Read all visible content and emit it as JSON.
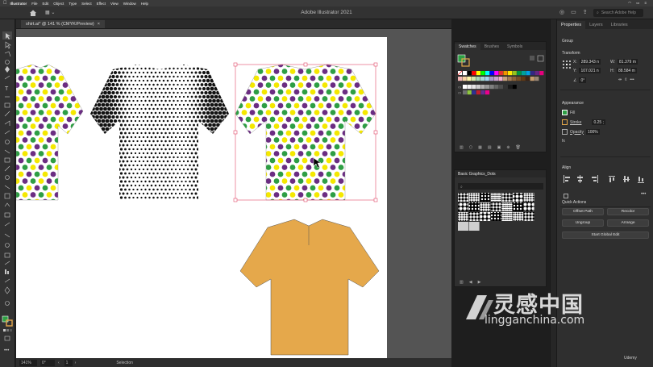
{
  "menubar": {
    "items": [
      "Illustrator",
      "File",
      "Edit",
      "Object",
      "Type",
      "Select",
      "Effect",
      "View",
      "Window",
      "Help"
    ]
  },
  "appbar": {
    "title": "Adobe Illustrator 2021",
    "search_placeholder": "Search Adobe Help"
  },
  "document": {
    "tab_label": "shirt.ai* @ 141 % (CMYK/Preview)"
  },
  "status": {
    "zoom": "141%",
    "rotation": "0°",
    "page": "1",
    "mode": "Selection"
  },
  "swatches_panel": {
    "tabs": [
      "Swatches",
      "Brushes",
      "Symbols"
    ],
    "swatch_colors": [
      "#ffffff",
      "#000000",
      "#ff0000",
      "#ffff00",
      "#00ff00",
      "#00ffff",
      "#0000ff",
      "#ff00ff",
      "#e6312e",
      "#f29400",
      "#ffe800",
      "#95c11f",
      "#009640",
      "#00a19a",
      "#009fe3",
      "#312783",
      "#662483",
      "#e5007d",
      "#f4b6b6",
      "#f9d2a3",
      "#fff7a8",
      "#d5e6a7",
      "#a8d5b4",
      "#a5d8d4",
      "#a4d4f0",
      "#a89bc9",
      "#c9a4cd",
      "#f2b0cf",
      "#c7a27c",
      "#a67c52",
      "#8c6239",
      "#754c24",
      "#603913",
      "#3c2415",
      "#c69c6d",
      "#998675",
      "#ffffff",
      "#f2f2f2",
      "#e6e6e6",
      "#cccccc",
      "#b3b3b3",
      "#999999",
      "#808080",
      "#666666",
      "#4d4d4d",
      "#333333",
      "#1a1a1a",
      "#000000",
      "#6d6e71",
      "#8dc63f",
      "#2e3192",
      "#be1e2d",
      "#662d91",
      "#ec008c"
    ]
  },
  "graphics_panel": {
    "title": "Basic Graphics_Dots"
  },
  "properties": {
    "tabs": [
      "Properties",
      "Layers",
      "Libraries"
    ],
    "group_label": "Group",
    "transform_label": "Transform",
    "x_label": "X:",
    "x_value": "289.343 n",
    "w_label": "W:",
    "w_value": "81.379 m",
    "y_label": "Y:",
    "y_value": "107.021 n",
    "h_label": "H:",
    "h_value": "88.584 m",
    "angle_value": "0°",
    "appearance_label": "Appearance",
    "fill_label": "Fill",
    "stroke_label": "Stroke",
    "stroke_value": "0.25 ;",
    "opacity_label": "Opacity",
    "opacity_value": "100%",
    "fx_label": "fx",
    "align_label": "Align",
    "quick_actions_label": "Quick Actions",
    "btn_offset_path": "Offset Path",
    "btn_recolor": "Recolor",
    "btn_ungroup": "Ungroup",
    "btn_arrange": "Arrange",
    "btn_start_global_edit": "Start Global Edit"
  },
  "watermark": {
    "cn": "灵感中国",
    "en": "lingganchina.com",
    "udemy": "Udemy"
  },
  "colors": {
    "dot_green": "#2e9e44",
    "dot_purple": "#6b2d82",
    "dot_yellow": "#f4e800",
    "shirt_orange": "#e5a84b",
    "selection": "#e04b6b"
  }
}
